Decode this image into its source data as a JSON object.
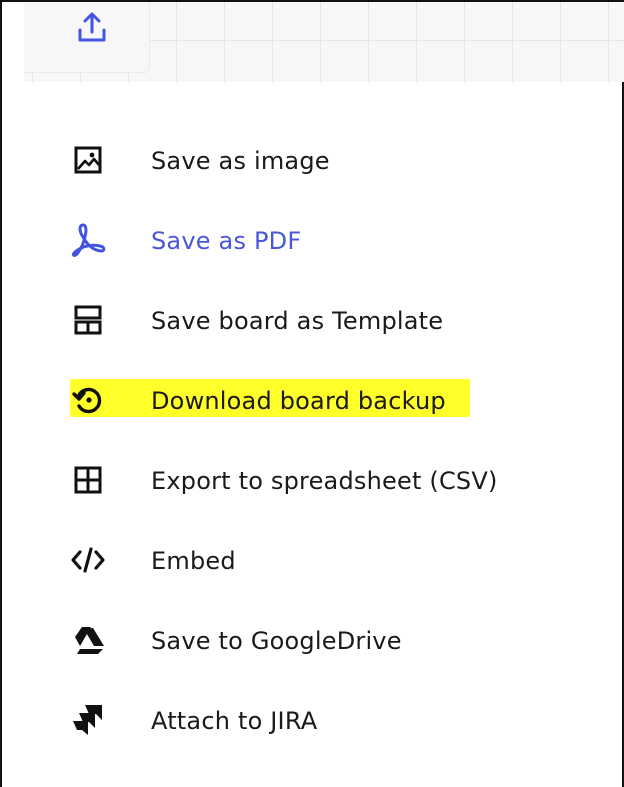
{
  "toolbar": {
    "export_button_icon": "upload-icon"
  },
  "menu": {
    "items": [
      {
        "id": "save-image",
        "label": "Save as image",
        "icon": "image-icon"
      },
      {
        "id": "save-pdf",
        "label": "Save as PDF",
        "icon": "pdf-icon",
        "color": "#4a57d8"
      },
      {
        "id": "save-template",
        "label": "Save board as Template",
        "icon": "template-icon"
      },
      {
        "id": "download-backup",
        "label": "Download board backup",
        "icon": "backup-icon",
        "highlight_color": "#ffff2a"
      },
      {
        "id": "export-csv",
        "label": "Export to spreadsheet (CSV)",
        "icon": "table-grid-icon"
      },
      {
        "id": "embed",
        "label": "Embed",
        "icon": "code-icon"
      },
      {
        "id": "save-googledrive",
        "label": "Save to GoogleDrive",
        "icon": "google-drive-icon"
      },
      {
        "id": "attach-jira",
        "label": "Attach to JIRA",
        "icon": "jira-icon"
      }
    ]
  }
}
